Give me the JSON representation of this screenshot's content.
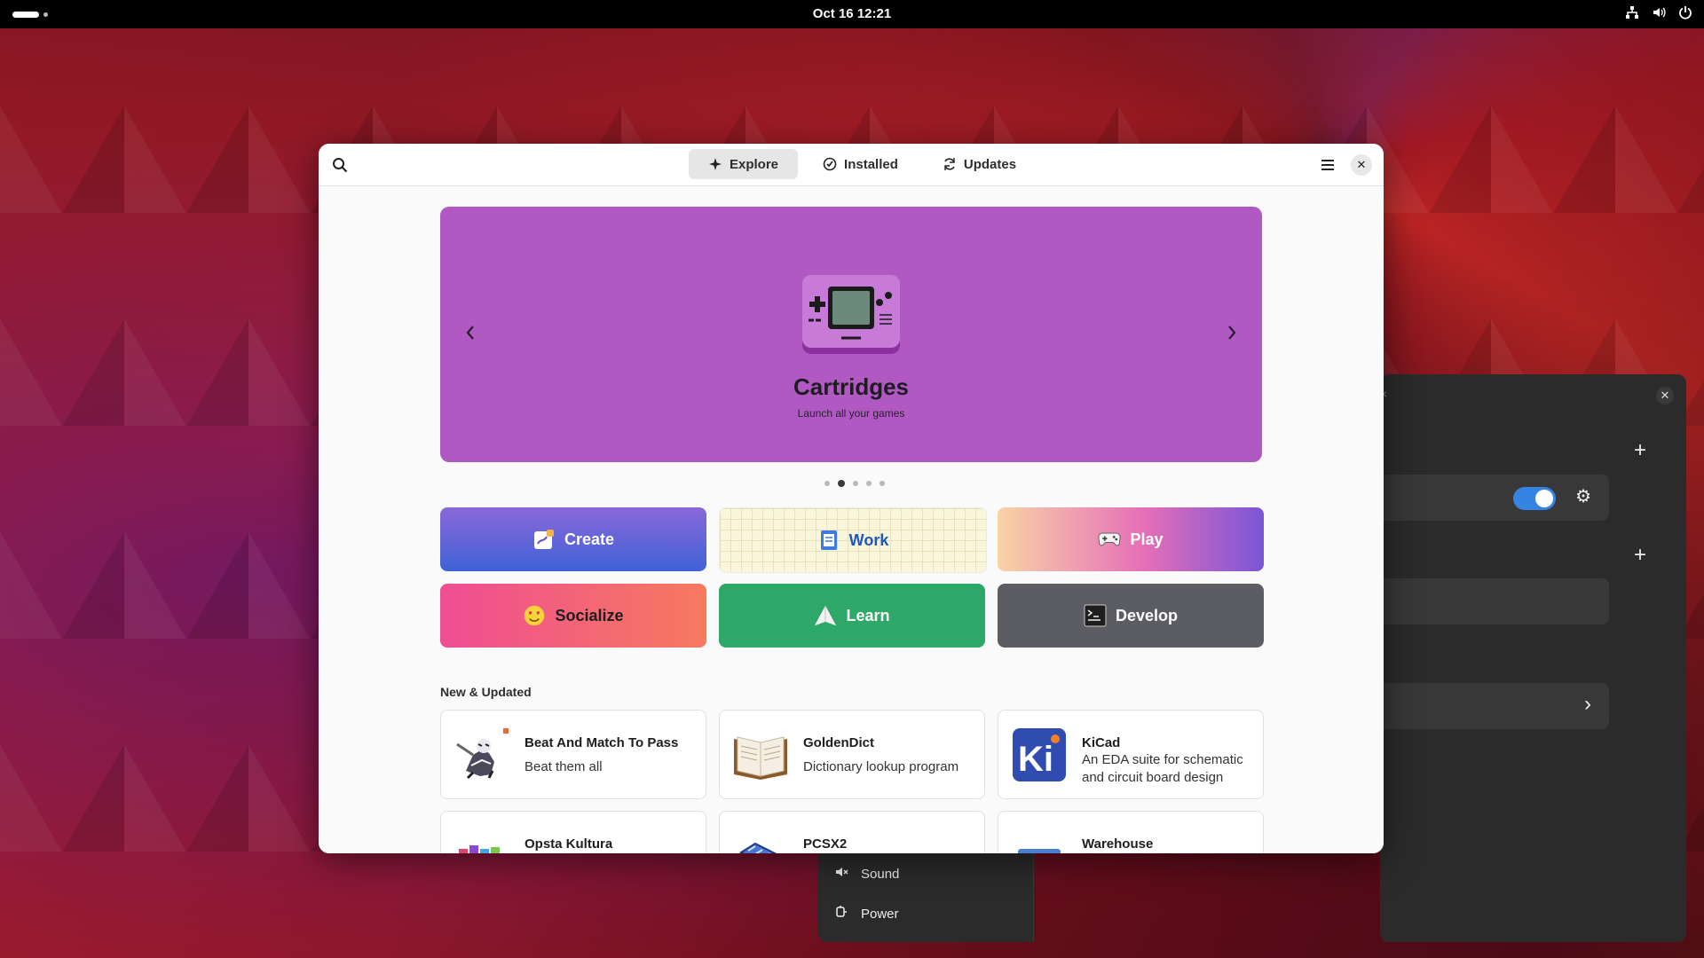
{
  "topbar": {
    "clock": "Oct 16  12:21",
    "tray_icons": [
      "network-icon",
      "volume-icon",
      "power-icon"
    ]
  },
  "window": {
    "tabs": [
      {
        "label": "Explore",
        "icon": "explore-icon",
        "active": true
      },
      {
        "label": "Installed",
        "icon": "check-circle-icon",
        "active": false
      },
      {
        "label": "Updates",
        "icon": "refresh-icon",
        "active": false
      }
    ],
    "banner": {
      "title": "Cartridges",
      "subtitle": "Launch all your games",
      "background": "#b159c3",
      "page_count": 5,
      "active_page": 2
    },
    "categories": [
      {
        "label": "Create",
        "icon": "create-icon"
      },
      {
        "label": "Work",
        "icon": "work-icon"
      },
      {
        "label": "Play",
        "icon": "gamepad-icon"
      },
      {
        "label": "Socialize",
        "icon": "emoji-icon"
      },
      {
        "label": "Learn",
        "icon": "learn-icon"
      },
      {
        "label": "Develop",
        "icon": "terminal-icon"
      }
    ],
    "new_updated": {
      "title": "New & Updated",
      "apps": [
        {
          "name": "Beat And Match To Pass",
          "desc": "Beat them all"
        },
        {
          "name": "GoldenDict",
          "desc": "Dictionary lookup program"
        },
        {
          "name": "KiCad",
          "desc": "An EDA suite for schematic and circuit board design"
        },
        {
          "name": "Opsta Kultura",
          "desc": ""
        },
        {
          "name": "PCSX2",
          "desc": ""
        },
        {
          "name": "Warehouse",
          "desc": ""
        }
      ]
    }
  },
  "quick_menu": {
    "items": [
      {
        "label": "Sound",
        "icon": "sound-icon"
      },
      {
        "label": "Power",
        "icon": "power-plug-icon"
      }
    ]
  },
  "colors": {
    "accent": "#3584e4",
    "learn": "#2ea868",
    "develop": "#5c5c63"
  }
}
